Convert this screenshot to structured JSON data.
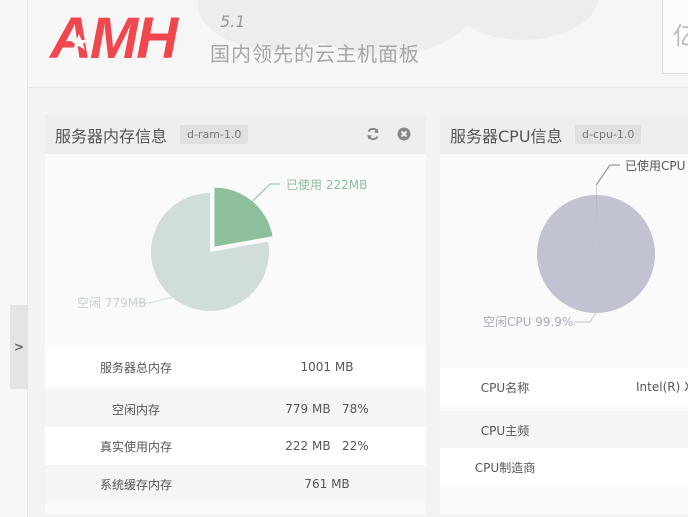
{
  "header": {
    "logo_text": "AMH",
    "version": "5.1",
    "slogan": "国内领先的云主机面板",
    "corner_glyph": "亿"
  },
  "sidebar": {
    "expand_label": ">"
  },
  "ram_panel": {
    "title": "服务器内存信息",
    "tag": "d-ram-1.0",
    "chart_data": {
      "type": "pie",
      "title": "",
      "slices": [
        {
          "label": "已使用 222MB",
          "value": 222,
          "color": "#8cbf9b"
        },
        {
          "label": "空闲 779MB",
          "value": 779,
          "color": "#d1ddda"
        }
      ]
    },
    "rows": [
      {
        "label": "服务器总内存",
        "value": "1001 MB"
      },
      {
        "label": "空闲内存",
        "value": "779 MB   78%"
      },
      {
        "label": "真实使用内存",
        "value": "222 MB   22%"
      },
      {
        "label": "系统缓存内存",
        "value": "761 MB"
      }
    ]
  },
  "cpu_panel": {
    "title": "服务器CPU信息",
    "tag": "d-cpu-1.0",
    "chart_data": {
      "type": "pie",
      "title": "",
      "slices": [
        {
          "label": "已使用CPU",
          "value": 0.1,
          "color": "#7c7f99"
        },
        {
          "label": "空闲CPU 99.9%",
          "value": 99.9,
          "color": "#c1c2d2"
        }
      ]
    },
    "rows": [
      {
        "label": "CPU名称",
        "value": "Intel(R) Xe"
      },
      {
        "label": "CPU主频",
        "value": ""
      },
      {
        "label": "CPU制造商",
        "value": ""
      }
    ]
  },
  "colors": {
    "logo_red": "#f0464d",
    "ram_used": "#8cbf9b",
    "ram_free": "#d1ddda",
    "cpu_used": "#7c7f99",
    "cpu_free": "#c1c2d2"
  }
}
